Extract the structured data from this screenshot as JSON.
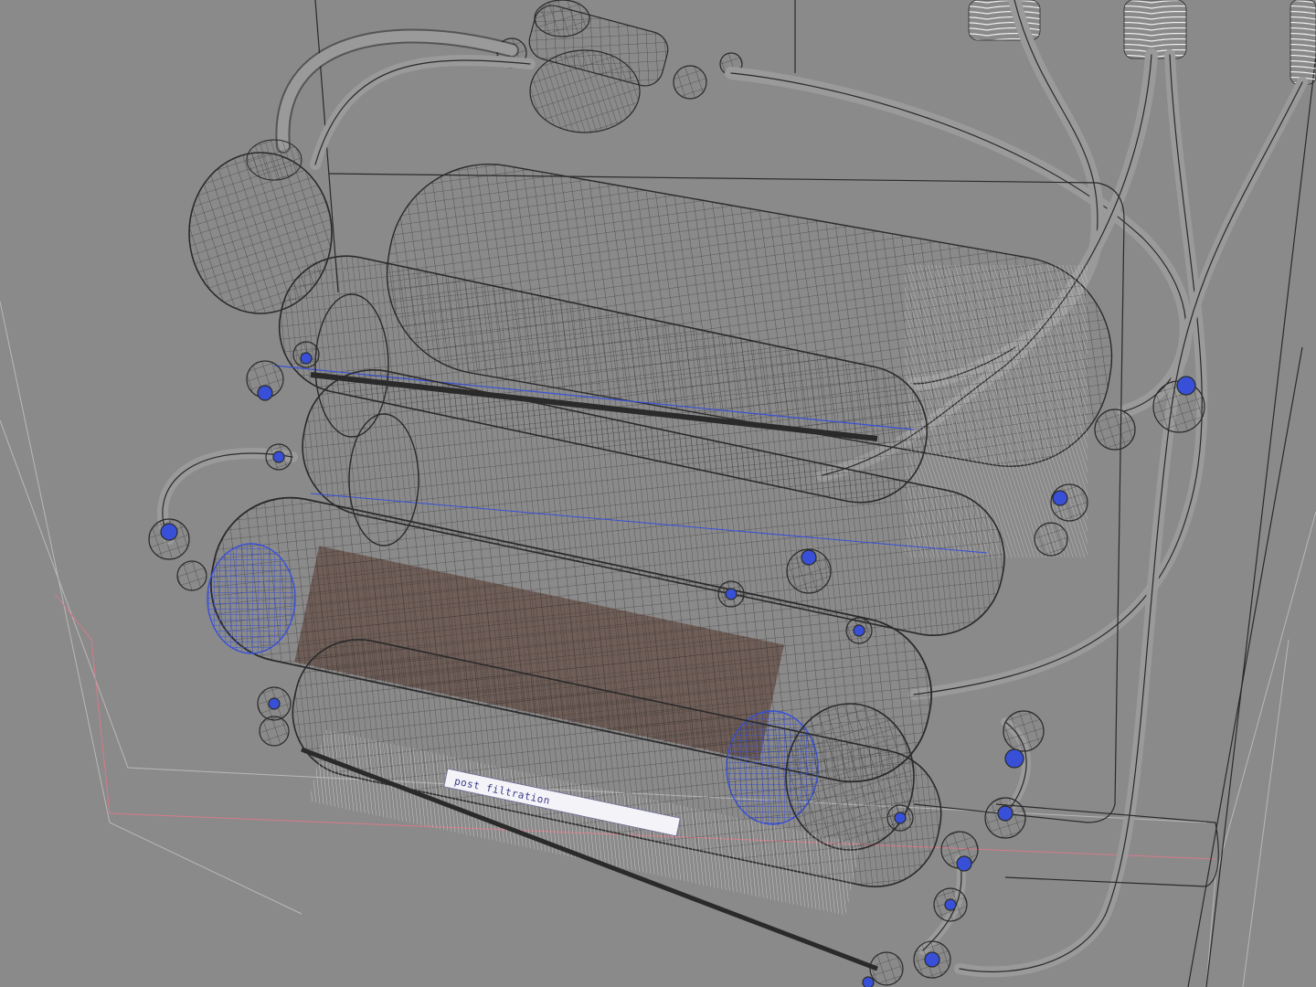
{
  "viewport": {
    "background": "#8a8a8a",
    "wire_color": "#2a2a2a",
    "wire_light": "#d0d0d0",
    "accent_blue": "#3850d8",
    "accent_brown": "#5a3a30",
    "bounds_red": "#d87a8a"
  },
  "scene": {
    "filter_label": "post filtration"
  }
}
